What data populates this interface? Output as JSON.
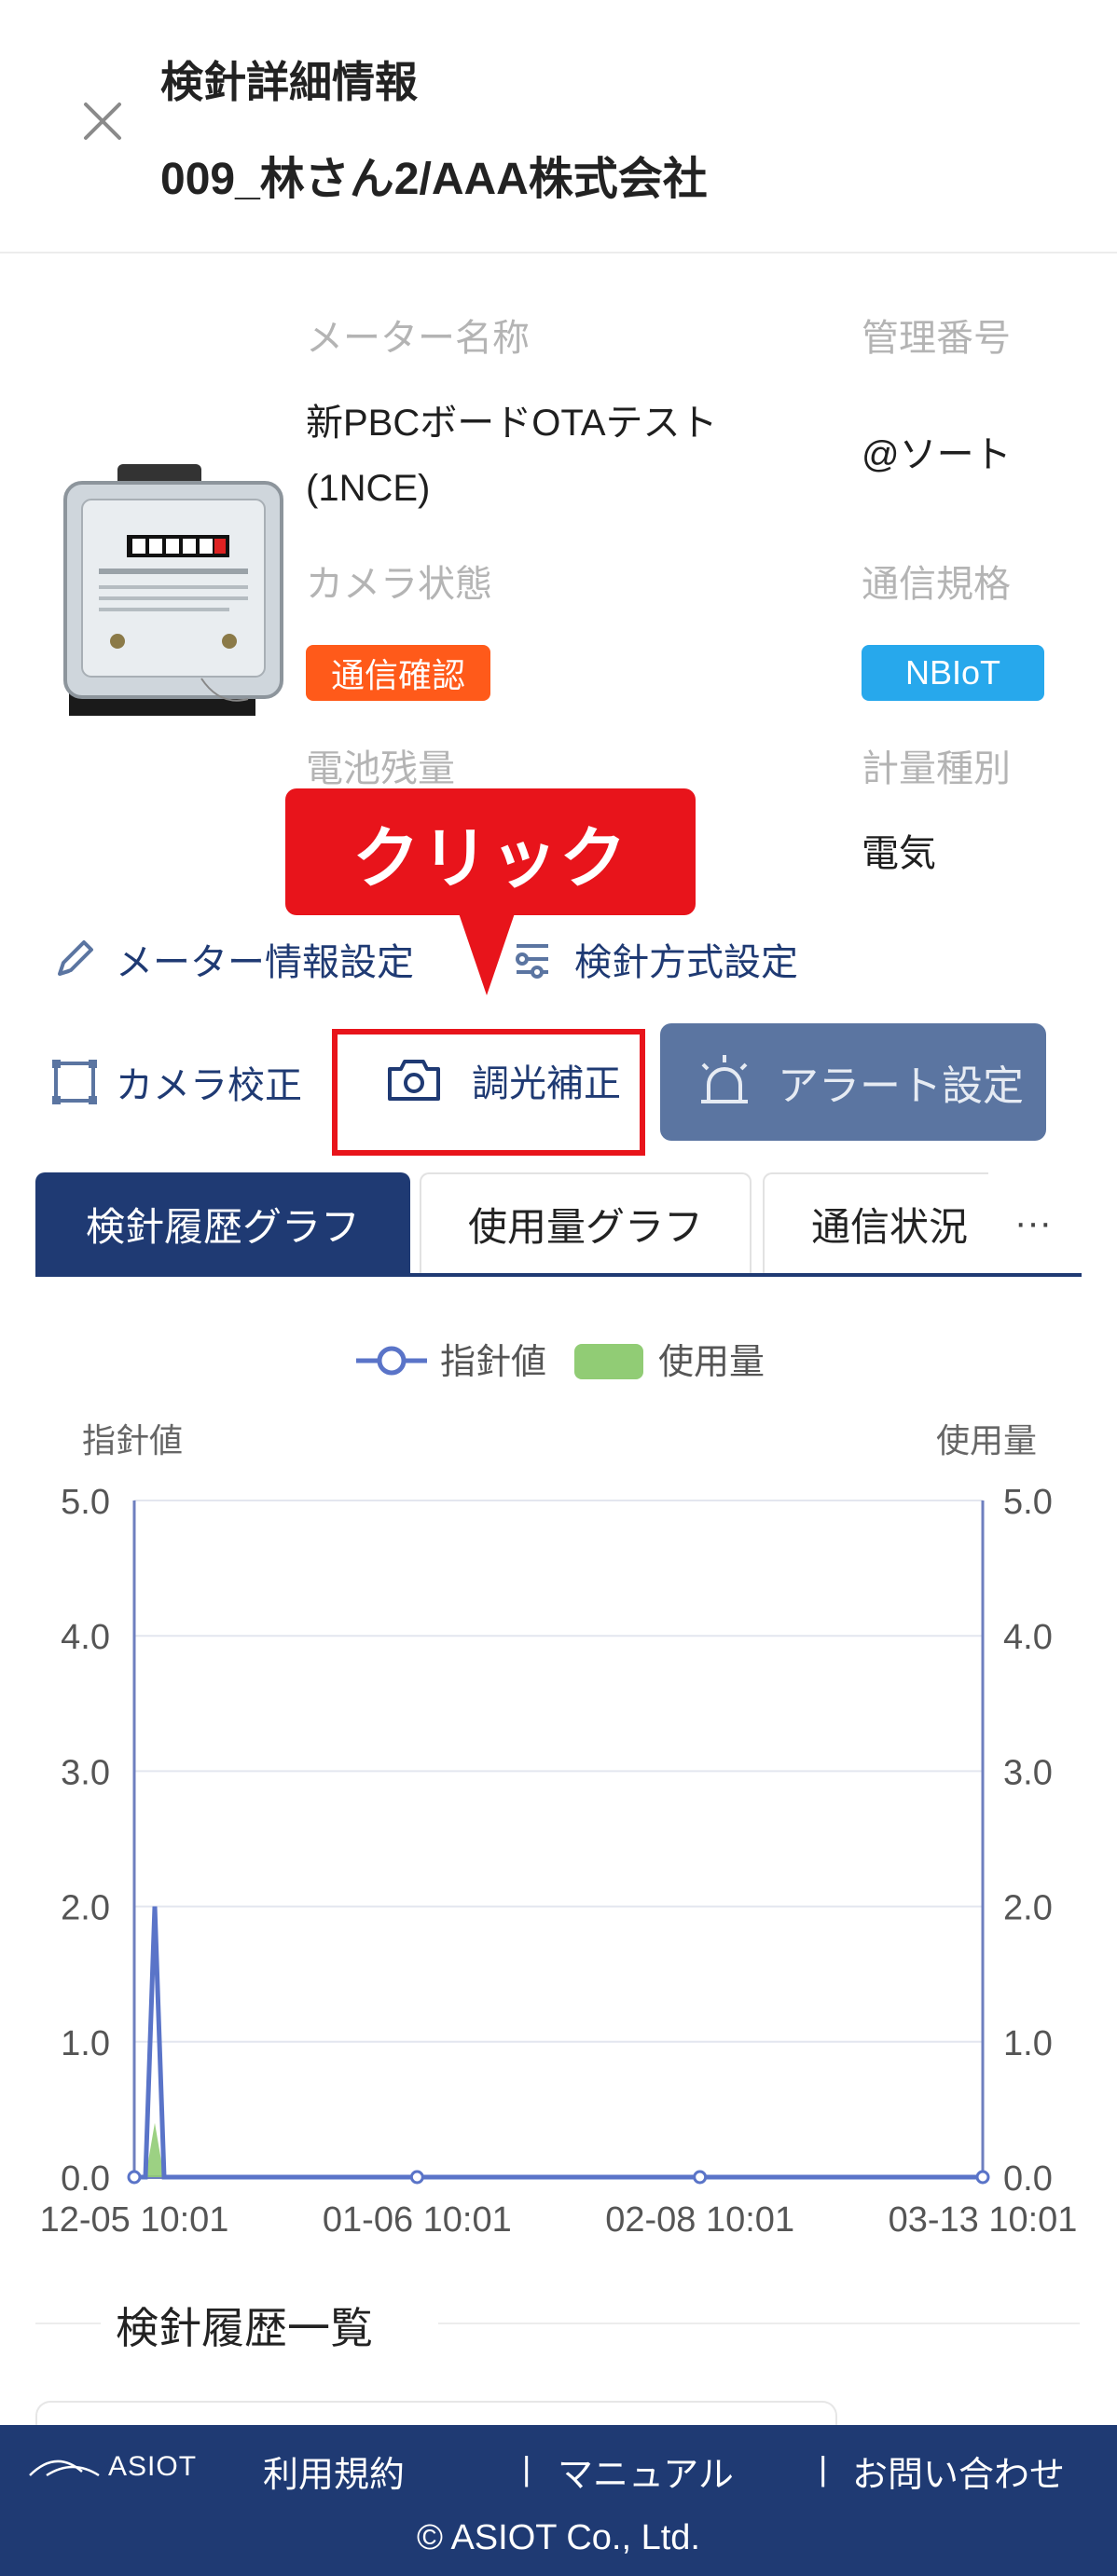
{
  "header": {
    "title": "検針詳細情報",
    "subtitle": "009_林さん2/AAA株式会社"
  },
  "meter": {
    "name_label": "メーター名称",
    "name_value_line1": "新PBCボードOTAテスト",
    "name_value_line2": "(1NCE)",
    "id_label": "管理番号",
    "id_value": "@ソート",
    "camera_label": "カメラ状態",
    "camera_badge": "通信確認",
    "comm_label": "通信規格",
    "comm_badge": "NBIoT",
    "battery_label": "電池残量",
    "measure_label": "計量種別",
    "measure_value": "電気"
  },
  "actions": {
    "meter_settings": "メーター情報設定",
    "reading_method": "検針方式設定",
    "camera_calibration": "カメラ校正",
    "light_adjust": "調光補正",
    "alert_settings": "アラート設定"
  },
  "callout": {
    "text": "クリック"
  },
  "tabs": {
    "items": [
      "検針履歴グラフ",
      "使用量グラフ",
      "通信状況"
    ],
    "more": "···"
  },
  "chart_data": {
    "type": "line",
    "legend": [
      "指針値",
      "使用量"
    ],
    "ylabel": "指針値",
    "y2label": "使用量",
    "ylim": [
      0,
      5
    ],
    "yticks": [
      "0.0",
      "1.0",
      "2.0",
      "3.0",
      "4.0",
      "5.0"
    ],
    "xticks": [
      "12-05 10:01",
      "01-06 10:01",
      "02-08 10:01",
      "03-13 10:01"
    ],
    "series": [
      {
        "name": "指針値",
        "type": "line",
        "x": [
          "12-05 10:01",
          "12-08",
          "12-10",
          "12-12",
          "01-06 10:01",
          "02-08 10:01",
          "03-13 10:01"
        ],
        "values": [
          0,
          0,
          2.0,
          0,
          0,
          0,
          0
        ]
      },
      {
        "name": "使用量",
        "type": "bar",
        "x": [
          "12-08",
          "12-10",
          "12-12"
        ],
        "values": [
          0,
          0.4,
          0
        ]
      }
    ],
    "colors": {
      "line": "#5a74c8",
      "bar": "#91cc75"
    }
  },
  "list": {
    "title": "検針履歴一覧"
  },
  "footer": {
    "logo": "ASIOT",
    "links": [
      "利用規約",
      "マニュアル",
      "お問い合わせ"
    ],
    "separator": "|",
    "copyright": "© ASIOT Co., Ltd."
  }
}
